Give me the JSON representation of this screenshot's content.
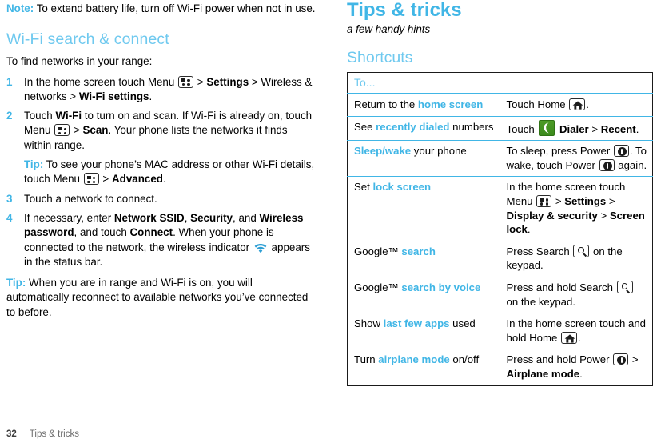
{
  "colors": {
    "accent_blue": "#41b6e6",
    "heading_blue": "#6fc9ef",
    "dialer_green": "#4c9c26",
    "rule_black": "#1a1a1a"
  },
  "left_column": {
    "note": {
      "label": "Note:",
      "text": " To extend battery life, turn off Wi-Fi power when not in use."
    },
    "section_heading": "Wi-Fi search & connect",
    "intro": "To find networks in your range:",
    "steps": [
      {
        "num": "1",
        "parts": [
          {
            "t": "In the home screen touch Menu ",
            "s": "n"
          },
          {
            "t": "menu-key",
            "s": "icon"
          },
          {
            "t": " > ",
            "s": "n"
          },
          {
            "t": "Settings",
            "s": "b"
          },
          {
            "t": " > Wireless & networks > ",
            "s": "n"
          },
          {
            "t": "Wi-Fi settings",
            "s": "b"
          },
          {
            "t": ".",
            "s": "n"
          }
        ]
      },
      {
        "num": "2",
        "parts": [
          {
            "t": "Touch ",
            "s": "n"
          },
          {
            "t": "Wi-Fi",
            "s": "b"
          },
          {
            "t": " to turn on and scan. If Wi-Fi is already on, touch Menu ",
            "s": "n"
          },
          {
            "t": "menu-key",
            "s": "icon"
          },
          {
            "t": " > ",
            "s": "n"
          },
          {
            "t": "Scan",
            "s": "b"
          },
          {
            "t": ". Your phone lists the networks it finds within range.",
            "s": "n"
          }
        ],
        "sub_tip": {
          "label": "Tip:",
          "parts": [
            {
              "t": " To see your phone’s MAC address or other Wi-Fi details, touch Menu ",
              "s": "n"
            },
            {
              "t": "menu-key",
              "s": "icon"
            },
            {
              "t": " > ",
              "s": "n"
            },
            {
              "t": "Advanced",
              "s": "b"
            },
            {
              "t": ".",
              "s": "n"
            }
          ]
        }
      },
      {
        "num": "3",
        "parts": [
          {
            "t": "Touch a network to connect.",
            "s": "n"
          }
        ]
      },
      {
        "num": "4",
        "parts": [
          {
            "t": "If necessary, enter ",
            "s": "n"
          },
          {
            "t": "Network SSID",
            "s": "b"
          },
          {
            "t": ", ",
            "s": "n"
          },
          {
            "t": "Security",
            "s": "b"
          },
          {
            "t": ", and ",
            "s": "n"
          },
          {
            "t": "Wireless password",
            "s": "b"
          },
          {
            "t": ", and touch ",
            "s": "n"
          },
          {
            "t": "Connect",
            "s": "b"
          },
          {
            "t": ". When your phone is connected to the network, the wireless indicator ",
            "s": "n"
          },
          {
            "t": "wifi-icon",
            "s": "icon"
          },
          {
            "t": " appears in the status bar.",
            "s": "n"
          }
        ]
      }
    ],
    "tail_tip": {
      "label": "Tip:",
      "text": " When you are in range and Wi-Fi is on, you will automatically reconnect to available networks you’ve connected to before."
    }
  },
  "right_column": {
    "chapter_title": "Tips & tricks",
    "chapter_subtitle": "a few handy hints",
    "section_heading": "Shortcuts",
    "table": {
      "header": "To...",
      "rows": [
        {
          "task": [
            {
              "t": "Return to the ",
              "s": "n"
            },
            {
              "t": "home screen",
              "s": "blue-b"
            }
          ],
          "how": [
            {
              "t": "Touch Home ",
              "s": "n"
            },
            {
              "t": "home-key",
              "s": "icon"
            },
            {
              "t": ".",
              "s": "n"
            }
          ]
        },
        {
          "task": [
            {
              "t": "See ",
              "s": "n"
            },
            {
              "t": "recently dialed",
              "s": "blue-b"
            },
            {
              "t": " numbers",
              "s": "n"
            }
          ],
          "how": [
            {
              "t": "Touch ",
              "s": "n"
            },
            {
              "t": "dialer-icon",
              "s": "icon"
            },
            {
              "t": " ",
              "s": "n"
            },
            {
              "t": "Dialer",
              "s": "b"
            },
            {
              "t": " > ",
              "s": "n"
            },
            {
              "t": "Recent",
              "s": "b"
            },
            {
              "t": ".",
              "s": "n"
            }
          ]
        },
        {
          "task": [
            {
              "t": "Sleep/wake",
              "s": "blue-b"
            },
            {
              "t": " your phone",
              "s": "n"
            }
          ],
          "how": [
            {
              "t": "To sleep, press Power ",
              "s": "n"
            },
            {
              "t": "power-key",
              "s": "icon"
            },
            {
              "t": ". To wake, touch Power ",
              "s": "n"
            },
            {
              "t": "power-key",
              "s": "icon"
            },
            {
              "t": " again.",
              "s": "n"
            }
          ]
        },
        {
          "task": [
            {
              "t": "Set ",
              "s": "n"
            },
            {
              "t": "lock screen",
              "s": "blue-b"
            }
          ],
          "how": [
            {
              "t": "In the home screen touch Menu ",
              "s": "n"
            },
            {
              "t": "menu-key",
              "s": "icon"
            },
            {
              "t": " > ",
              "s": "n"
            },
            {
              "t": "Settings",
              "s": "b"
            },
            {
              "t": " > ",
              "s": "n"
            },
            {
              "t": "Display & security",
              "s": "b"
            },
            {
              "t": " > ",
              "s": "n"
            },
            {
              "t": "Screen lock",
              "s": "b"
            },
            {
              "t": ".",
              "s": "n"
            }
          ]
        },
        {
          "task": [
            {
              "t": "Google™ ",
              "s": "n"
            },
            {
              "t": "search",
              "s": "blue-b"
            }
          ],
          "how": [
            {
              "t": "Press Search ",
              "s": "n"
            },
            {
              "t": "search-key",
              "s": "icon"
            },
            {
              "t": " on the keypad.",
              "s": "n"
            }
          ]
        },
        {
          "task": [
            {
              "t": "Google™ ",
              "s": "n"
            },
            {
              "t": "search by voice",
              "s": "blue-b"
            }
          ],
          "how": [
            {
              "t": "Press and hold Search ",
              "s": "n"
            },
            {
              "t": "search-key",
              "s": "icon"
            },
            {
              "t": " on the keypad.",
              "s": "n"
            }
          ]
        },
        {
          "task": [
            {
              "t": "Show ",
              "s": "n"
            },
            {
              "t": "last few apps",
              "s": "blue-b"
            },
            {
              "t": " used",
              "s": "n"
            }
          ],
          "how": [
            {
              "t": "In the home screen touch and hold Home ",
              "s": "n"
            },
            {
              "t": "home-key",
              "s": "icon"
            },
            {
              "t": ".",
              "s": "n"
            }
          ]
        },
        {
          "task": [
            {
              "t": "Turn ",
              "s": "n"
            },
            {
              "t": "airplane mode",
              "s": "blue-b"
            },
            {
              "t": " on/off",
              "s": "n"
            }
          ],
          "how": [
            {
              "t": "Press and hold Power ",
              "s": "n"
            },
            {
              "t": "power-key",
              "s": "icon"
            },
            {
              "t": " > ",
              "s": "n"
            },
            {
              "t": "Airplane mode",
              "s": "b"
            },
            {
              "t": ".",
              "s": "n"
            }
          ]
        }
      ]
    }
  },
  "footer": {
    "page_number": "32",
    "chapter": "Tips & tricks"
  }
}
